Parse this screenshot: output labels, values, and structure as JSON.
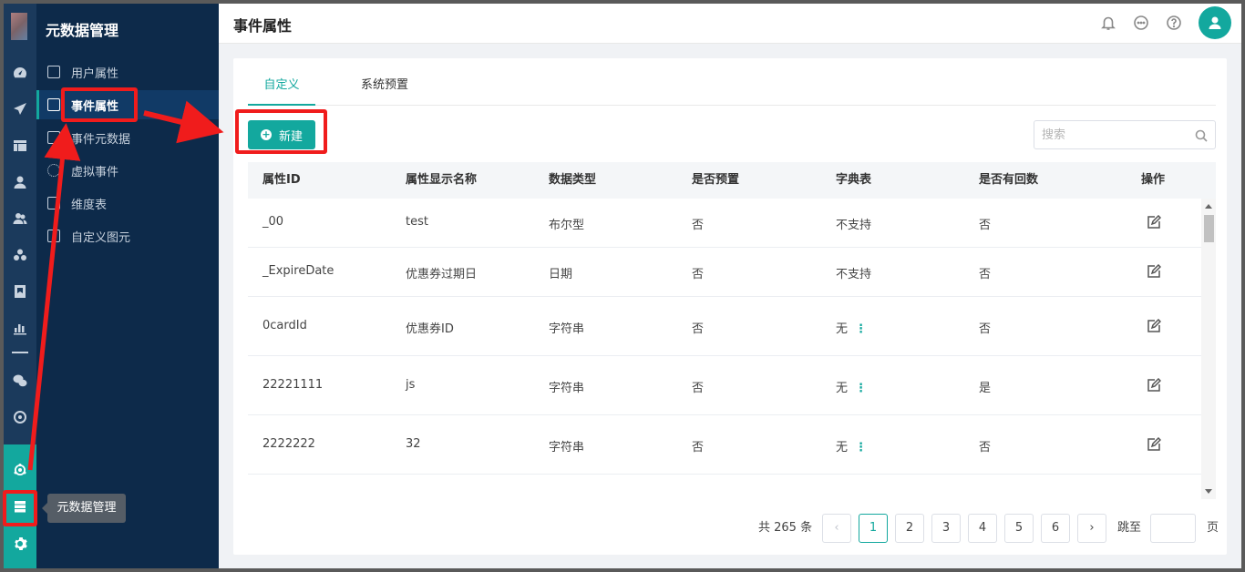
{
  "sidebar": {
    "title": "元数据管理",
    "items": [
      {
        "label": "用户属性"
      },
      {
        "label": "事件属性"
      },
      {
        "label": "事件元数据"
      },
      {
        "label": "虚拟事件"
      },
      {
        "label": "维度表"
      },
      {
        "label": "自定义图元"
      }
    ]
  },
  "rail": {
    "icons": [
      "dashboard-icon",
      "send-icon",
      "layout-icon",
      "user-icon",
      "users-icon",
      "cluster-icon",
      "bookmark-icon",
      "bar-chart-icon",
      "wechat-icon",
      "target-icon",
      "network-icon",
      "database-icon",
      "settings-icon"
    ],
    "tooltip": "元数据管理"
  },
  "header": {
    "title": "事件属性",
    "icons": [
      "bell-icon",
      "message-icon",
      "help-icon",
      "avatar-icon"
    ]
  },
  "tabs": [
    {
      "label": "自定义",
      "active": true
    },
    {
      "label": "系统预置",
      "active": false
    }
  ],
  "toolbar": {
    "new_label": "新建",
    "search_placeholder": "搜索"
  },
  "table": {
    "columns": [
      "属性ID",
      "属性显示名称",
      "数据类型",
      "是否预置",
      "字典表",
      "是否有回数",
      "操作"
    ],
    "rows": [
      {
        "id": "_00",
        "name": "test",
        "type": "布尔型",
        "preset": "否",
        "dict": "不支持",
        "has_kebab": false,
        "back": "否"
      },
      {
        "id": "_ExpireDate",
        "name": "优惠券过期日",
        "type": "日期",
        "preset": "否",
        "dict": "不支持",
        "has_kebab": false,
        "back": "否"
      },
      {
        "id": "0cardId",
        "name": "优惠券ID",
        "type": "字符串",
        "preset": "否",
        "dict": "无",
        "has_kebab": true,
        "back": "否"
      },
      {
        "id": "22221111",
        "name": "js",
        "type": "字符串",
        "preset": "否",
        "dict": "无",
        "has_kebab": true,
        "back": "是"
      },
      {
        "id": "2222222",
        "name": "32",
        "type": "字符串",
        "preset": "否",
        "dict": "无",
        "has_kebab": true,
        "back": "否"
      }
    ]
  },
  "pagination": {
    "total_text": "共 265 条",
    "pages": [
      "1",
      "2",
      "3",
      "4",
      "5",
      "6"
    ],
    "current": "1",
    "jump_label": "跳至",
    "page_suffix": "页"
  },
  "colors": {
    "accent": "#13a89e",
    "sidebar_bg": "#0d2a4a",
    "rail_bg": "#1b3a5c",
    "annotation": "#f01c1c"
  }
}
